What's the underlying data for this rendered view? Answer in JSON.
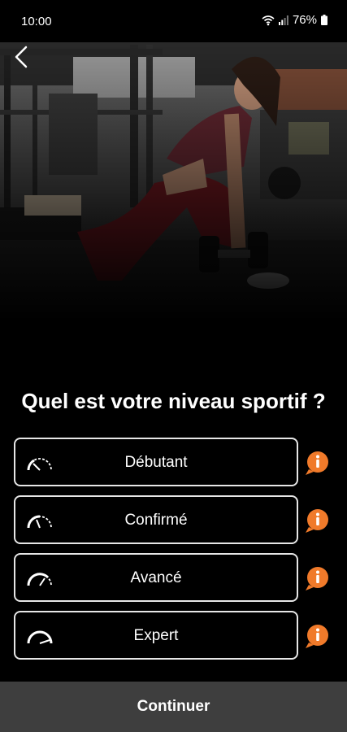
{
  "status_bar": {
    "time": "10:00",
    "battery": "76%"
  },
  "hero": {
    "image_icon": "gym-photo-woman-dumbbell-row"
  },
  "back": {
    "icon": "arrow-left-icon"
  },
  "question": "Quel est votre niveau sportif ?",
  "levels": [
    {
      "label": "Débutant",
      "icon": "gauge-low-icon",
      "gauge_level": 0.25
    },
    {
      "label": "Confirmé",
      "icon": "gauge-medium-icon",
      "gauge_level": 0.5
    },
    {
      "label": "Avancé",
      "icon": "gauge-high-icon",
      "gauge_level": 0.75
    },
    {
      "label": "Expert",
      "icon": "gauge-max-icon",
      "gauge_level": 1.0
    }
  ],
  "info_icon": "info-bubble-icon",
  "continue_label": "Continuer",
  "colors": {
    "background": "#000000",
    "accent": "#f07a2a",
    "button_border": "#e6e6e6",
    "continue_bar": "#3e3e3e"
  }
}
